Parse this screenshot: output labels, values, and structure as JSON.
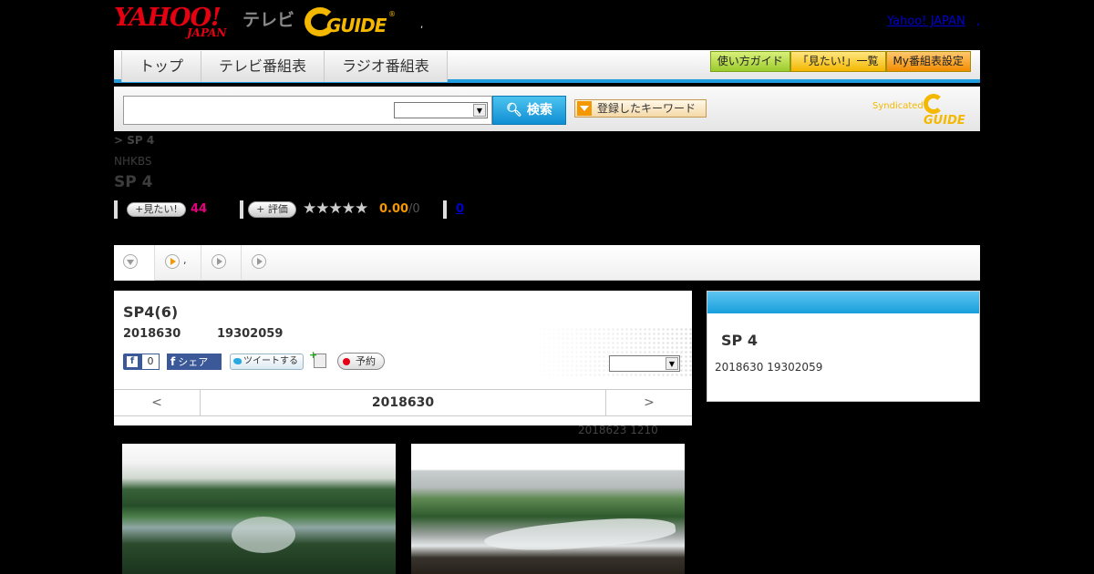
{
  "header": {
    "yahoo_logo_text": "YAHOO!",
    "yahoo_logo_sub": "JAPAN",
    "tv_label": "テレビ",
    "gguide_logo_text": "GUIDE",
    "gguide_reg": "®",
    "dot": ",",
    "yahoo_japan_link": "Yahoo! JAPAN",
    "yahoo_japan_dot": ","
  },
  "nav": {
    "tabs": [
      {
        "label": "トップ"
      },
      {
        "label": "テレビ番組表"
      },
      {
        "label": "ラジオ番組表"
      }
    ],
    "buttons": [
      {
        "label": "使い方ガイド"
      },
      {
        "label": "「見たい!」一覧"
      },
      {
        "label": "My番組表設定"
      }
    ]
  },
  "search": {
    "input_value": "",
    "select_value": "",
    "button_label": "検索",
    "keyword_button_label": "登録したキーワード",
    "syndicated_label": "Syndicated",
    "syndicated_logo": "GUIDE"
  },
  "program": {
    "breadcrumb": "> SP 4",
    "channel": "NHKBS",
    "title": "SP 4",
    "mitai_label": "見たい!",
    "mitai_count": "44",
    "hyoka_label": "評価",
    "stars": "★★★★★",
    "score": "0.00",
    "score_total": "/0",
    "review_count": "0"
  },
  "tabs": {
    "items": [
      {
        "label": ""
      },
      {
        "label": ","
      },
      {
        "label": ""
      },
      {
        "label": ""
      }
    ]
  },
  "episode": {
    "title": "SP4(6)",
    "date": "2018630",
    "time": "19302059",
    "fb_like": "f",
    "fb_like_count": "0",
    "fb_share_f": "f",
    "fb_share_label": "シェア",
    "tweet_label": "ツイートする",
    "reserve_label": "予約",
    "select_value": "",
    "pager_prev": "<",
    "pager_date": "2018630",
    "pager_next": ">",
    "updated": "2018623  1210"
  },
  "side": {
    "title": "SP 4",
    "info": "2018630  19302059"
  },
  "colors": {
    "accent_blue": "#1f9ddc",
    "yahoo_red": "#e50012",
    "gguide_yellow": "#f5b800",
    "mitai_pink": "#e4007f",
    "score_orange": "#f39800"
  }
}
